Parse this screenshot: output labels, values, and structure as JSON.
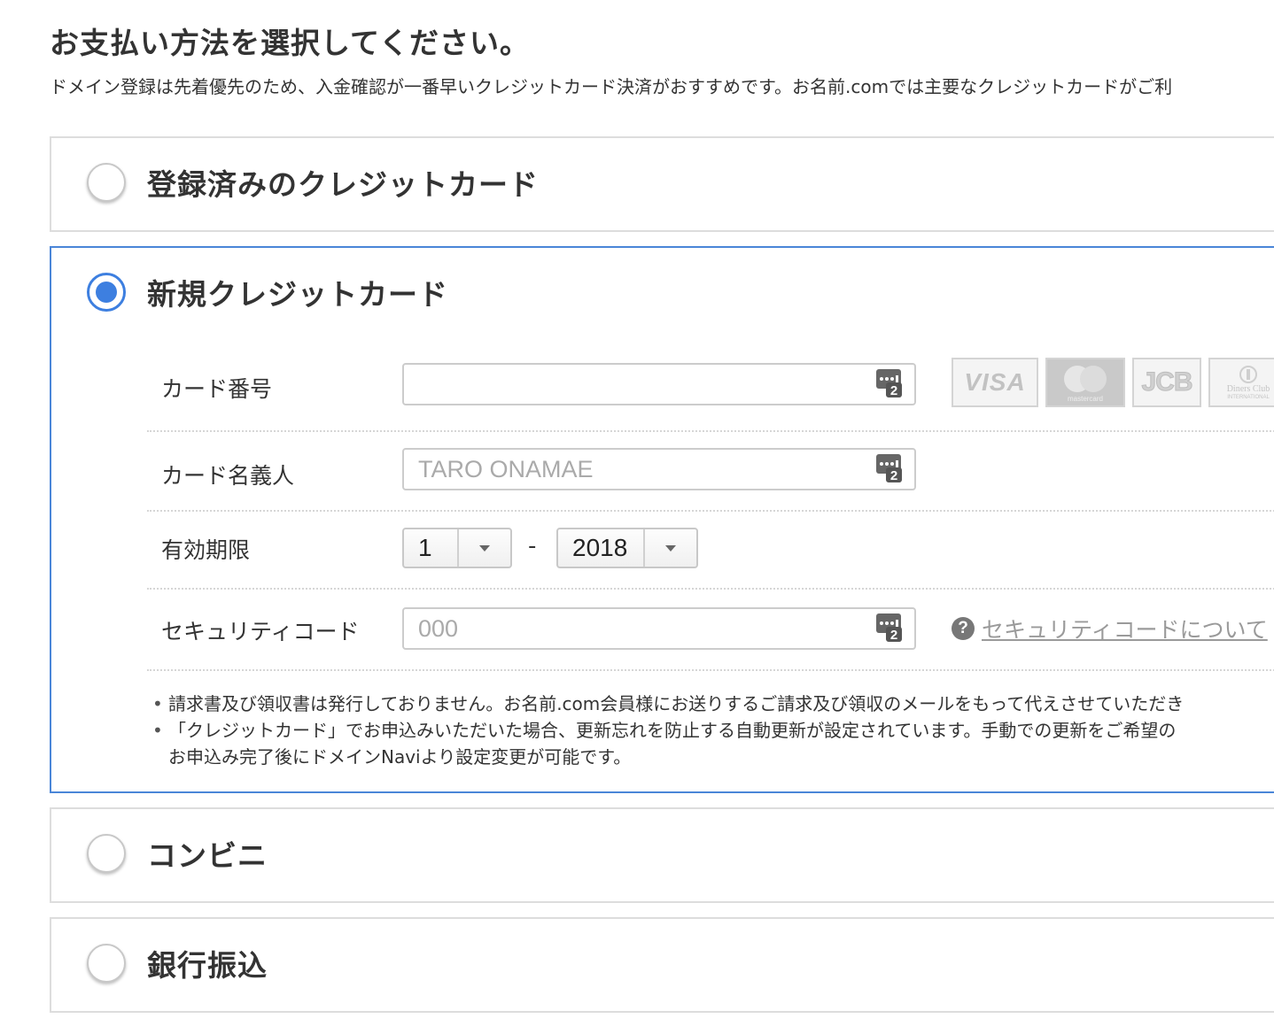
{
  "page": {
    "title": "お支払い方法を選択してください。",
    "description": "ドメイン登録は先着優先のため、入金確認が一番早いクレジットカード決済がおすすめです。お名前.comでは主要なクレジットカードがご利"
  },
  "options": {
    "registered_card": {
      "label": "登録済みのクレジットカード",
      "checked": false
    },
    "new_card": {
      "label": "新規クレジットカード",
      "checked": true
    },
    "convenience_store": {
      "label": "コンビニ",
      "checked": false
    },
    "bank_transfer": {
      "label": "銀行振込",
      "checked": false
    }
  },
  "form": {
    "card_number": {
      "label": "カード番号",
      "value": "",
      "placeholder": ""
    },
    "card_holder": {
      "label": "カード名義人",
      "value": "",
      "placeholder": "TARO ONAMAE"
    },
    "expiry": {
      "label": "有効期限",
      "month": "1",
      "separator": "-",
      "year": "2018"
    },
    "security_code": {
      "label": "セキュリティコード",
      "value": "",
      "placeholder": "000",
      "help_link": "セキュリティコードについて"
    }
  },
  "card_brands": [
    {
      "name": "VISA",
      "text": "VISA"
    },
    {
      "name": "mastercard",
      "text": "mastercard"
    },
    {
      "name": "JCB",
      "text": "JCB"
    },
    {
      "name": "Diners Club",
      "text": "Diners Club",
      "subtext": "INTERNATIONAL"
    }
  ],
  "notes": [
    "請求書及び領収書は発行しておりません。お名前.com会員様にお送りするご請求及び領収のメールをもって代えさせていただき",
    "「クレジットカード」でお申込みいただいた場合、更新忘れを防止する自動更新が設定されています。手動での更新をご希望の",
    "お申込み完了後にドメインNaviより設定変更が可能です。"
  ],
  "colors": {
    "accent": "#3d7fe0",
    "selected_border": "#4a86d8",
    "box_border": "#dddddd"
  }
}
